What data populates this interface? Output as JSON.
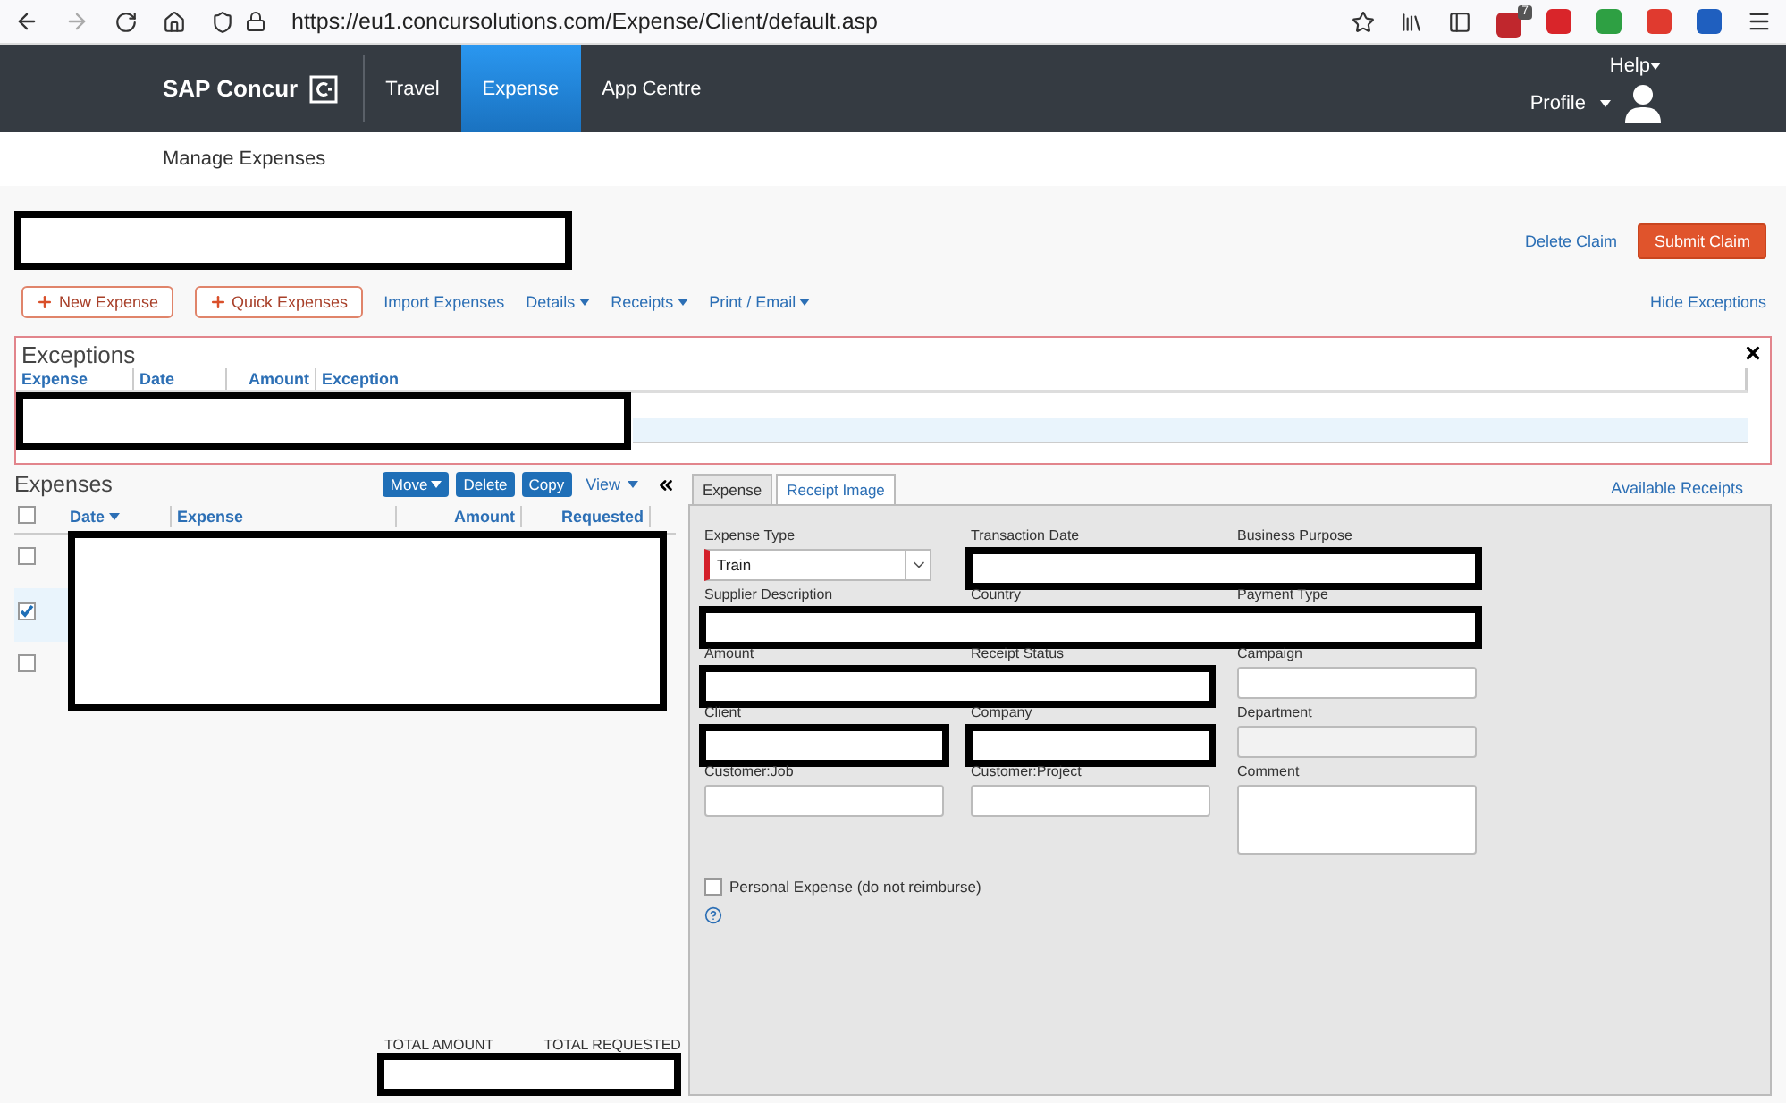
{
  "browser": {
    "url": "https://eu1.concursolutions.com/Expense/Client/default.asp",
    "badge": "7"
  },
  "nav": {
    "logo": "SAP Concur",
    "tabs": [
      {
        "label": "Travel",
        "selected": false
      },
      {
        "label": "Expense",
        "selected": true
      },
      {
        "label": "App Centre",
        "selected": false
      }
    ],
    "help": "Help",
    "profile": "Profile"
  },
  "subnav": {
    "title": "Manage Expenses"
  },
  "header": {
    "delete": "Delete Claim",
    "submit": "Submit Claim"
  },
  "toolbar": {
    "items": [
      {
        "label": "New Expense",
        "kind": "add"
      },
      {
        "label": "Quick Expenses",
        "kind": "add"
      },
      {
        "label": "Import Expenses",
        "kind": "link"
      },
      {
        "label": "Details",
        "kind": "menu"
      },
      {
        "label": "Receipts",
        "kind": "menu"
      },
      {
        "label": "Print / Email",
        "kind": "menu"
      }
    ],
    "hide": "Hide Exceptions"
  },
  "exceptions": {
    "title": "Exceptions",
    "columns": [
      {
        "label": "Expense"
      },
      {
        "label": "Date"
      },
      {
        "label": "Amount"
      },
      {
        "label": "Exception"
      }
    ]
  },
  "expenses": {
    "title": "Expenses",
    "buttons": [
      {
        "label": "Move",
        "kind": "menu"
      },
      {
        "label": "Delete",
        "kind": "plain"
      },
      {
        "label": "Copy",
        "kind": "plain"
      }
    ],
    "view": "View",
    "select_all": {
      "checked": false
    },
    "columns": [
      {
        "label": "Date",
        "sorted": true
      },
      {
        "label": "Expense",
        "sorted": false
      },
      {
        "label": "Amount",
        "sorted": false
      },
      {
        "label": "Requested",
        "sorted": false
      }
    ],
    "rows": [
      {
        "checked": false,
        "selected": false
      },
      {
        "checked": true,
        "selected": true
      },
      {
        "checked": false,
        "selected": false
      }
    ],
    "totals": [
      "TOTAL AMOUNT",
      "TOTAL REQUESTED"
    ]
  },
  "detail": {
    "tabs": [
      {
        "label": "Expense",
        "selected": true
      },
      {
        "label": "Receipt Image",
        "selected": false
      }
    ],
    "available_receipts": "Available Receipts",
    "rows": [
      {
        "fields": [
          {
            "label": "Expense Type",
            "kind": "select",
            "value": "Train"
          },
          {
            "label": "Transaction Date",
            "redacted": true
          },
          {
            "label": "Business Purpose",
            "redacted": true,
            "joined": true
          }
        ]
      },
      {
        "fields": [
          {
            "label": "Supplier Description",
            "redacted": true
          },
          {
            "label": "Country",
            "redacted": true,
            "joined": true
          },
          {
            "label": "Payment Type",
            "redacted": true,
            "joined": true
          }
        ]
      },
      {
        "fields": [
          {
            "label": "Amount",
            "redacted": true
          },
          {
            "label": "Receipt Status",
            "redacted": true,
            "joined": true
          },
          {
            "label": "Campaign",
            "kind": "text"
          }
        ]
      },
      {
        "fields": [
          {
            "label": "Client",
            "redacted": true
          },
          {
            "label": "Company",
            "redacted": true
          },
          {
            "label": "Department",
            "kind": "disabled"
          }
        ]
      },
      {
        "fields": [
          {
            "label": "Customer:Job",
            "kind": "text"
          },
          {
            "label": "Customer:Project",
            "kind": "text"
          },
          {
            "label": "Comment",
            "kind": "textarea"
          }
        ]
      }
    ],
    "personal": {
      "label": "Personal Expense (do not reimburse)",
      "checked": false
    }
  }
}
